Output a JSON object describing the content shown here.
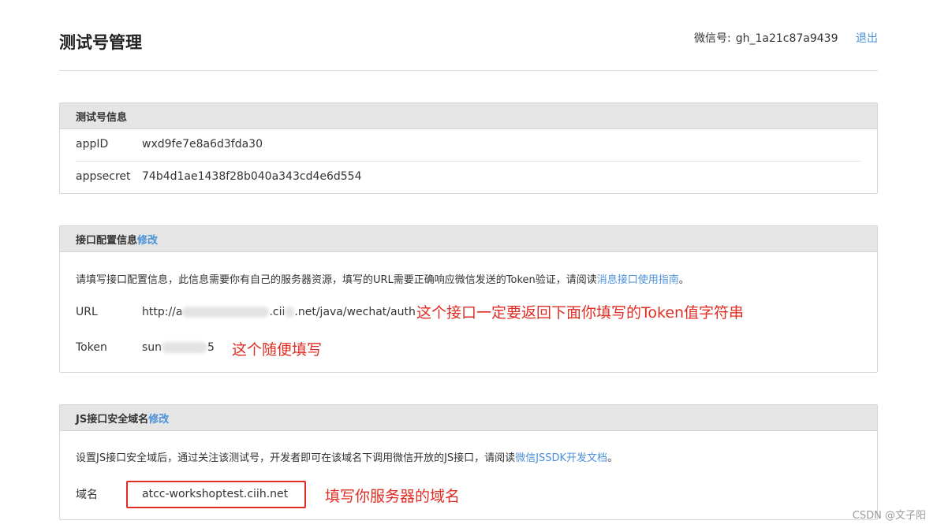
{
  "header": {
    "title": "测试号管理",
    "account_label": "微信号:",
    "account_id": "gh_1a21c87a9439",
    "logout": "退出"
  },
  "test_info": {
    "title": "测试号信息",
    "rows": [
      {
        "key": "appID",
        "value": "wxd9fe7e8a6d3fda30"
      },
      {
        "key": "appsecret",
        "value": "74b4d1ae1438f28b040a343cd4e6d554"
      }
    ]
  },
  "api_config": {
    "title": "接口配置信息",
    "edit": "修改",
    "desc_prefix": "请填写接口配置信息，此信息需要你有自己的服务器资源，填写的URL需要正确响应微信发送的Token验证，请阅读",
    "desc_link": "消息接口使用指南",
    "desc_suffix": "。",
    "url_label": "URL",
    "url_value_start": "http://a",
    "url_value_mid": ".cii",
    "url_value_end": ".net/java/wechat/auth",
    "token_label": "Token",
    "token_value_start": "sun",
    "token_value_end": "5",
    "url_annotation": "这个接口一定要返回下面你填写的Token值字符串",
    "token_annotation": "这个随便填写"
  },
  "js_domain": {
    "title": "JS接口安全域名",
    "edit": "修改",
    "desc_prefix": "设置JS接口安全域后，通过关注该测试号，开发者即可在该域名下调用微信开放的JS接口，请阅读",
    "desc_link": "微信JSSDK开发文档",
    "desc_suffix": "。",
    "domain_label": "域名",
    "domain_value": "atcc-workshoptest.ciih.net",
    "domain_annotation": "填写你服务器的域名"
  },
  "watermark": "CSDN @文子阳",
  "colors": {
    "accent": "#4a90d9",
    "annotation": "#e02d23",
    "panel_head": "#e5e5e5"
  }
}
